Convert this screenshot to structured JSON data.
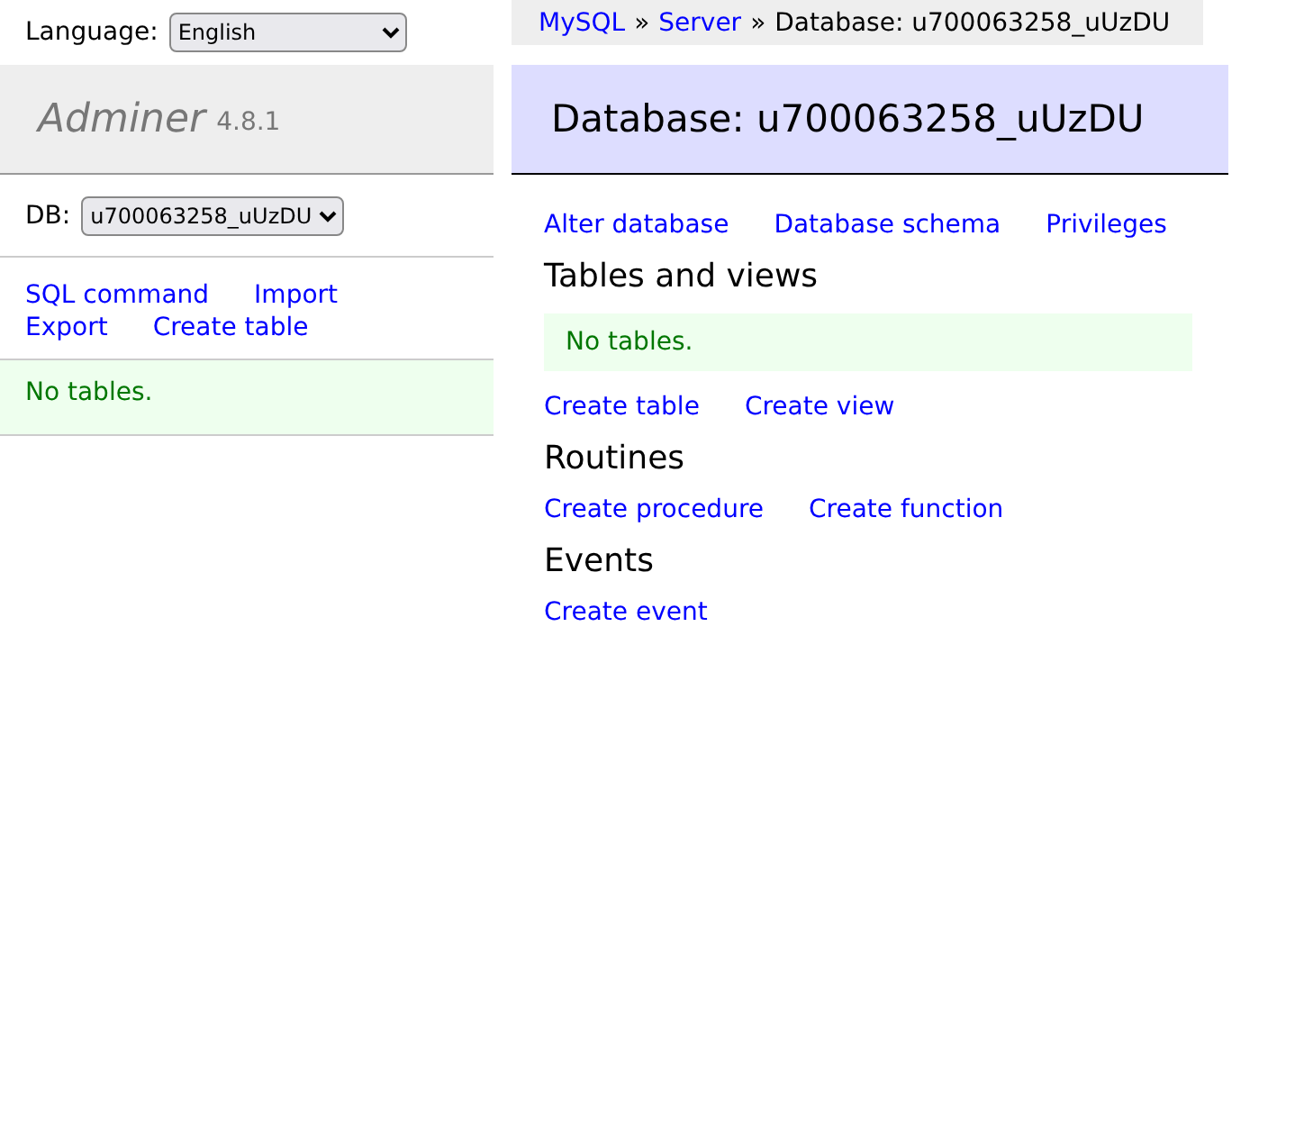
{
  "language": {
    "label": "Language:",
    "value": "English"
  },
  "logo": {
    "name": "Adminer",
    "version": "4.8.1"
  },
  "db": {
    "label": "DB:",
    "value": "u700063258_uUzDU"
  },
  "sidebar_links": [
    [
      "SQL command",
      "Import"
    ],
    [
      "Export",
      "Create table"
    ]
  ],
  "sidebar_message": "No tables.",
  "breadcrumb": [
    {
      "text": "MySQL",
      "kind": "link"
    },
    {
      "text": "»",
      "kind": "sep"
    },
    {
      "text": "Server",
      "kind": "link"
    },
    {
      "text": "»",
      "kind": "sep"
    },
    {
      "text": "Database: u700063258_uUzDU",
      "kind": "text"
    }
  ],
  "title": "Database: u700063258_uUzDU",
  "top_links": [
    "Alter database",
    "Database schema",
    "Privileges"
  ],
  "sections": [
    {
      "heading": "Tables and views",
      "message": "No tables.",
      "links": [
        "Create table",
        "Create view"
      ]
    },
    {
      "heading": "Routines",
      "links": [
        "Create procedure",
        "Create function"
      ]
    },
    {
      "heading": "Events",
      "links": [
        "Create event"
      ]
    }
  ]
}
